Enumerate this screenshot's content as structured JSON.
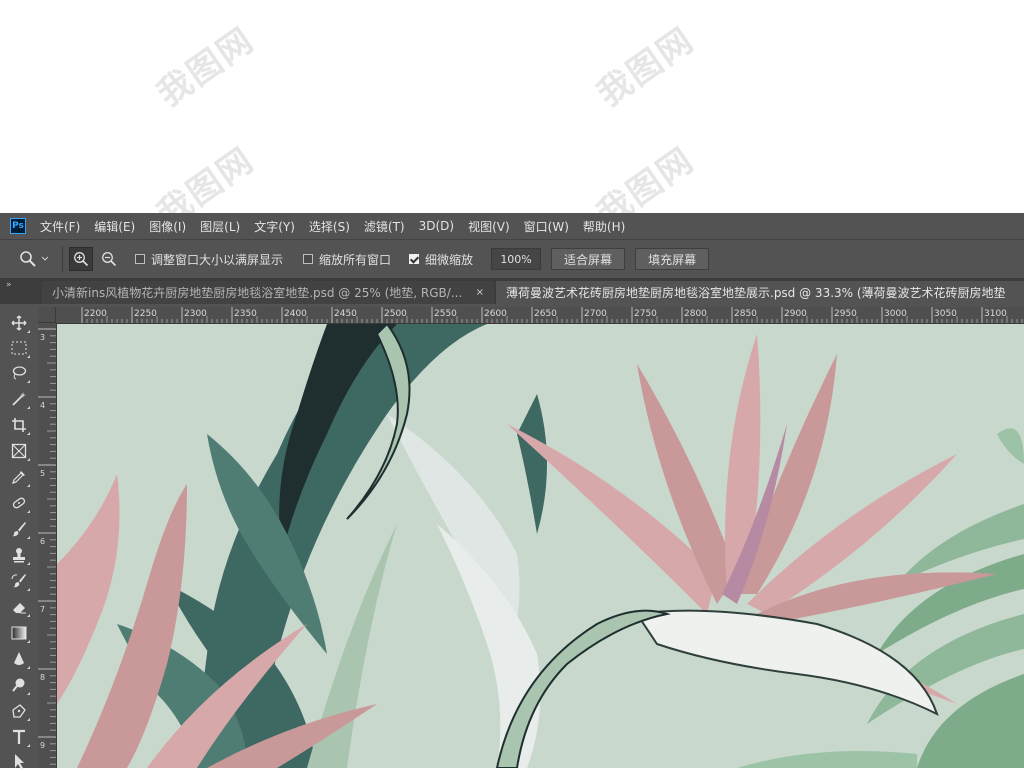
{
  "watermark_text": "我图网",
  "app": {
    "logo": "Ps"
  },
  "menu": [
    "文件(F)",
    "编辑(E)",
    "图像(I)",
    "图层(L)",
    "文字(Y)",
    "选择(S)",
    "滤镜(T)",
    "3D(D)",
    "视图(V)",
    "窗口(W)",
    "帮助(H)"
  ],
  "options": {
    "tool_icon": "zoom-icon",
    "resize_windows": {
      "label": "调整窗口大小以满屏显示",
      "checked": false
    },
    "zoom_all": {
      "label": "缩放所有窗口",
      "checked": false
    },
    "scrubby_zoom": {
      "label": "细微缩放",
      "checked": true
    },
    "zoom_value": "100%",
    "fit_screen": "适合屏幕",
    "fill_screen": "填充屏幕"
  },
  "tabs": [
    {
      "label": "小清新ins风植物花卉厨房地垫厨房地毯浴室地垫.psd @ 25% (地垫, RGB/...",
      "close": "×",
      "active": false
    },
    {
      "label": "薄荷曼波艺术花砖厨房地垫厨房地毯浴室地垫展示.psd @ 33.3% (薄荷曼波艺术花砖厨房地垫",
      "active": true
    }
  ],
  "ruler": {
    "horizontal": [
      "2200",
      "2250",
      "2300",
      "2350",
      "2400",
      "2450",
      "2500",
      "2550",
      "2600",
      "2650",
      "2700",
      "2750",
      "2800",
      "2850",
      "2900",
      "2950",
      "3000",
      "3050",
      "3100"
    ],
    "vertical": [
      "3",
      "4",
      "5",
      "6",
      "7",
      "8",
      "9"
    ]
  },
  "tools": [
    "move-icon",
    "marquee-icon",
    "lasso-icon",
    "magic-wand-icon",
    "crop-icon",
    "frame-icon",
    "eyedropper-icon",
    "healing-icon",
    "brush-icon",
    "stamp-icon",
    "history-brush-icon",
    "eraser-icon",
    "gradient-icon",
    "blur-icon",
    "dodge-icon",
    "pen-icon",
    "type-icon",
    "path-select-icon"
  ],
  "colors": {
    "panel": "#535353",
    "canvas_bg": "#c9d8cd",
    "leaf_dark": "#3e6862",
    "petal": "#d7a8a9"
  }
}
